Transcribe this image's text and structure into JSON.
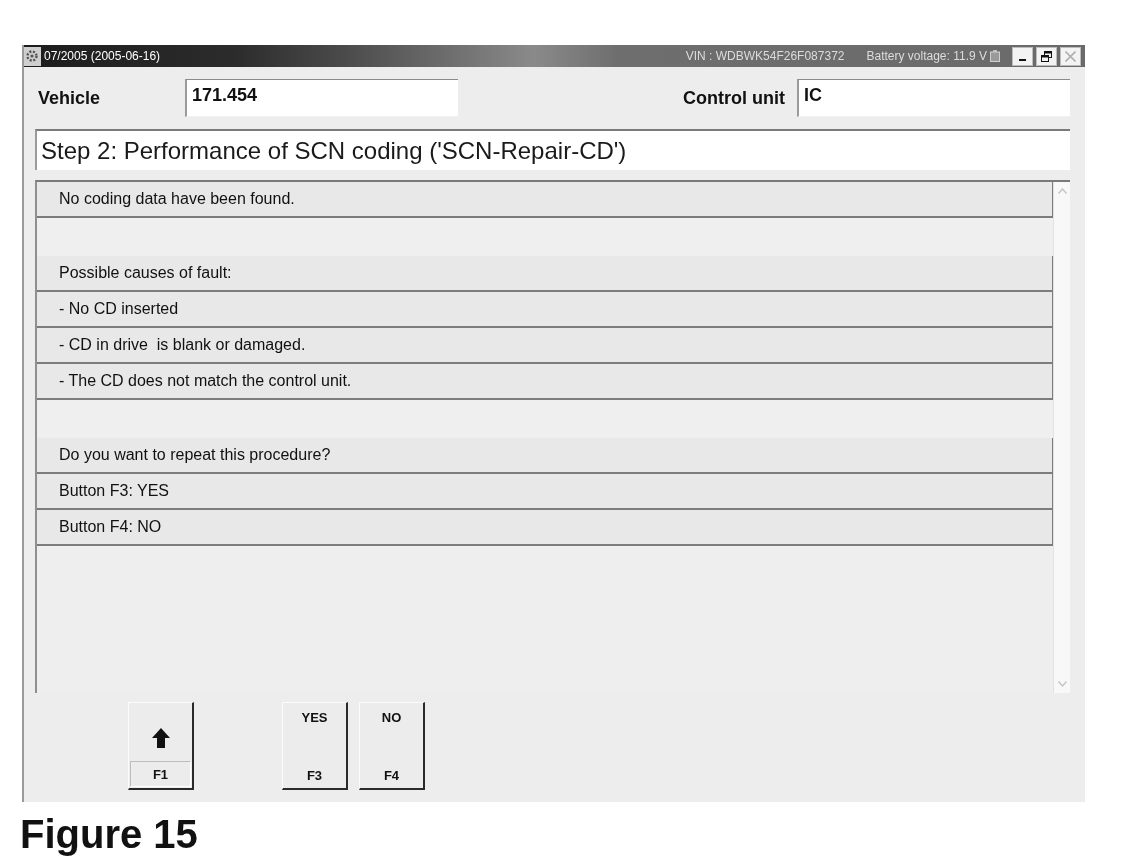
{
  "window": {
    "title": "07/2005 (2005-06-16)",
    "vin": "VIN : WDBWK54F26F087372",
    "battery_voltage": "Battery voltage: 11.9 V",
    "controls": [
      {
        "kind": "minimize",
        "disabled": false
      },
      {
        "kind": "restore",
        "disabled": false
      },
      {
        "kind": "close",
        "disabled": true
      }
    ]
  },
  "header": {
    "fields": [
      {
        "label": "Vehicle",
        "value": "171.454"
      },
      {
        "label": "Control unit",
        "value": "IC"
      }
    ]
  },
  "step_title": "Step 2: Performance of SCN coding ('SCN-Repair-CD')",
  "message_groups": [
    {
      "lines": [
        "No coding data have been found."
      ]
    },
    {
      "lines": [
        "Possible causes of fault:",
        "- No CD inserted",
        "- CD in drive  is blank or damaged.",
        "- The CD does not match the control unit."
      ]
    },
    {
      "lines": [
        "Do you want to repeat this procedure?",
        "Button F3: YES",
        "Button F4: NO"
      ]
    }
  ],
  "function_keys": [
    {
      "kind": "icon",
      "key": "F1"
    },
    {
      "kind": "blank"
    },
    {
      "kind": "text",
      "label": "YES",
      "key": "F3"
    },
    {
      "kind": "text",
      "label": "NO",
      "key": "F4"
    }
  ],
  "caption": "Figure 15"
}
